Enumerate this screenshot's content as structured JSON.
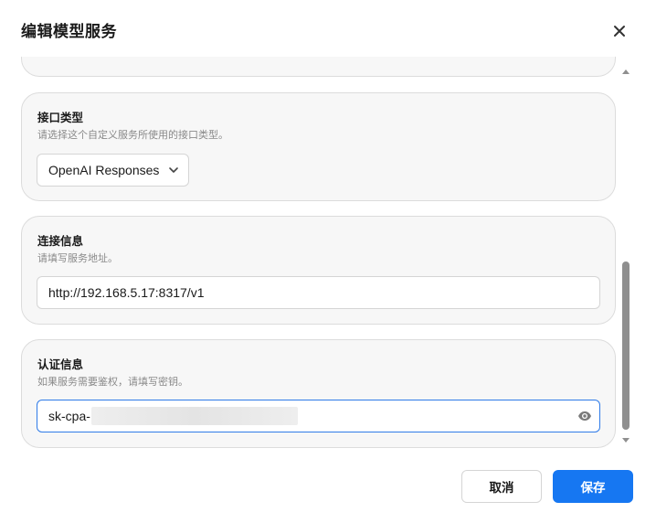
{
  "dialog": {
    "title": "编辑模型服务",
    "close_icon": "close-icon"
  },
  "sections": {
    "interface": {
      "title": "接口类型",
      "description": "请选择这个自定义服务所使用的接口类型。",
      "selected_value": "OpenAI Responses",
      "dropdown_icon": "chevron-down-icon"
    },
    "connection": {
      "title": "连接信息",
      "description": "请填写服务地址。",
      "value": "http://192.168.5.17:8317/v1"
    },
    "auth": {
      "title": "认证信息",
      "description": "如果服务需要鉴权，请填写密钥。",
      "value_visible": "sk-cpa-",
      "toggle_icon": "eye-icon"
    }
  },
  "footer": {
    "cancel_label": "取消",
    "save_label": "保存"
  },
  "colors": {
    "primary": "#1677f2",
    "focus_border": "#2f7be8",
    "card_background": "#f7f7f7",
    "scrollbar_thumb": "#8f8f8f"
  }
}
